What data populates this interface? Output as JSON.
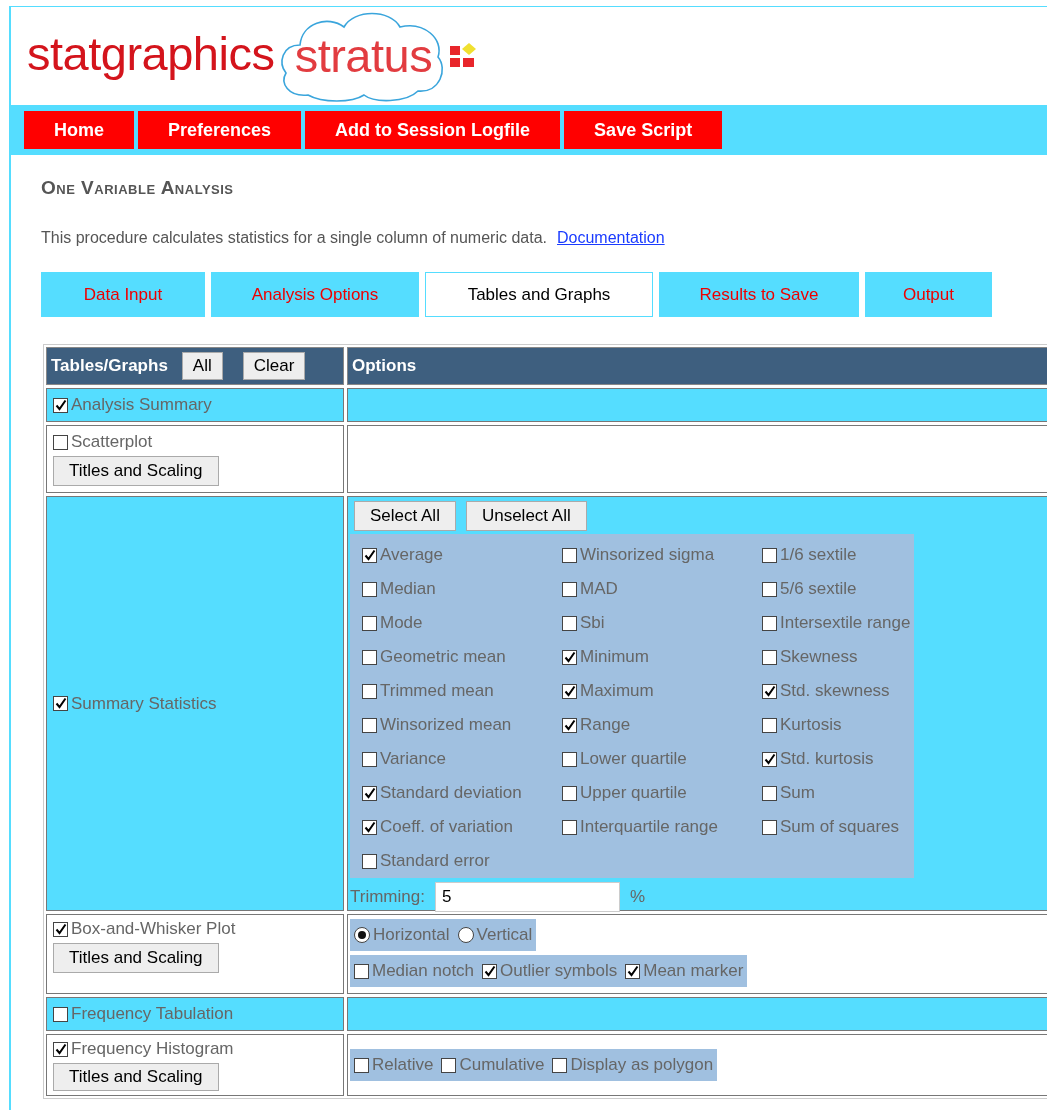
{
  "logo": {
    "brand": "statgraphics",
    "product": "stratus"
  },
  "nav": [
    "Home",
    "Preferences",
    "Add to Session Logfile",
    "Save Script"
  ],
  "page": {
    "title": "One Variable Analysis",
    "description": "This procedure calculates statistics for a single column of numeric data.",
    "link": "Documentation"
  },
  "tabs": [
    {
      "label": "Data Input",
      "selected": false
    },
    {
      "label": "Analysis Options",
      "selected": false
    },
    {
      "label": "Tables and Graphs",
      "selected": true
    },
    {
      "label": "Results to Save",
      "selected": false
    },
    {
      "label": "Output",
      "selected": false
    }
  ],
  "table": {
    "header": {
      "title": "Tables/Graphs",
      "buttons": [
        "All",
        "Clear"
      ],
      "options_title": "Options"
    },
    "rows": [
      {
        "label": "Analysis Summary",
        "checked": true,
        "options": {
          "kind": "empty"
        }
      },
      {
        "label": "Scatterplot",
        "checked": false,
        "button": "Titles and Scaling",
        "options": {
          "kind": "empty"
        }
      },
      {
        "label": "Summary Statistics",
        "checked": true,
        "options": {
          "kind": "statistics",
          "buttons": [
            "Select All",
            "Unselect All"
          ],
          "columns": [
            [
              {
                "label": "Average",
                "checked": true
              },
              {
                "label": "Median",
                "checked": false
              },
              {
                "label": "Mode",
                "checked": false
              },
              {
                "label": "Geometric mean",
                "checked": false
              },
              {
                "label": "Trimmed mean",
                "checked": false
              },
              {
                "label": "Winsorized mean",
                "checked": false
              },
              {
                "label": "Variance",
                "checked": false
              },
              {
                "label": "Standard deviation",
                "checked": true
              },
              {
                "label": "Coeff. of variation",
                "checked": true
              },
              {
                "label": "Standard error",
                "checked": false
              }
            ],
            [
              {
                "label": "Winsorized sigma",
                "checked": false
              },
              {
                "label": "MAD",
                "checked": false
              },
              {
                "label": "Sbi",
                "checked": false
              },
              {
                "label": "Minimum",
                "checked": true
              },
              {
                "label": "Maximum",
                "checked": true
              },
              {
                "label": "Range",
                "checked": true
              },
              {
                "label": "Lower quartile",
                "checked": false
              },
              {
                "label": "Upper quartile",
                "checked": false
              },
              {
                "label": "Interquartile range",
                "checked": false
              }
            ],
            [
              {
                "label": "1/6 sextile",
                "checked": false
              },
              {
                "label": "5/6 sextile",
                "checked": false
              },
              {
                "label": "Intersextile range",
                "checked": false
              },
              {
                "label": "Skewness",
                "checked": false
              },
              {
                "label": "Std. skewness",
                "checked": true
              },
              {
                "label": "Kurtosis",
                "checked": false
              },
              {
                "label": "Std. kurtosis",
                "checked": true
              },
              {
                "label": "Sum",
                "checked": false
              },
              {
                "label": "Sum of squares",
                "checked": false
              }
            ]
          ],
          "trimming": {
            "label": "Trimming:",
            "value": "5",
            "unit": "%"
          }
        }
      },
      {
        "label": "Box-and-Whisker Plot",
        "checked": true,
        "button": "Titles and Scaling",
        "options": {
          "kind": "groups",
          "groups": [
            {
              "kind": "radios",
              "items": [
                {
                  "label": "Horizontal",
                  "selected": true
                },
                {
                  "label": "Vertical",
                  "selected": false
                }
              ]
            },
            {
              "kind": "checks",
              "items": [
                {
                  "label": "Median notch",
                  "checked": false
                },
                {
                  "label": "Outlier symbols",
                  "checked": true
                },
                {
                  "label": "Mean marker",
                  "checked": true
                }
              ]
            }
          ]
        }
      },
      {
        "label": "Frequency Tabulation",
        "checked": false,
        "options": {
          "kind": "empty"
        }
      },
      {
        "label": "Frequency Histogram",
        "checked": true,
        "button": "Titles and Scaling",
        "options": {
          "kind": "groups",
          "groups": [
            {
              "kind": "checks",
              "items": [
                {
                  "label": "Relative",
                  "checked": false
                },
                {
                  "label": "Cumulative",
                  "checked": false
                },
                {
                  "label": "Display as polygon",
                  "checked": false
                }
              ]
            }
          ]
        }
      }
    ]
  }
}
